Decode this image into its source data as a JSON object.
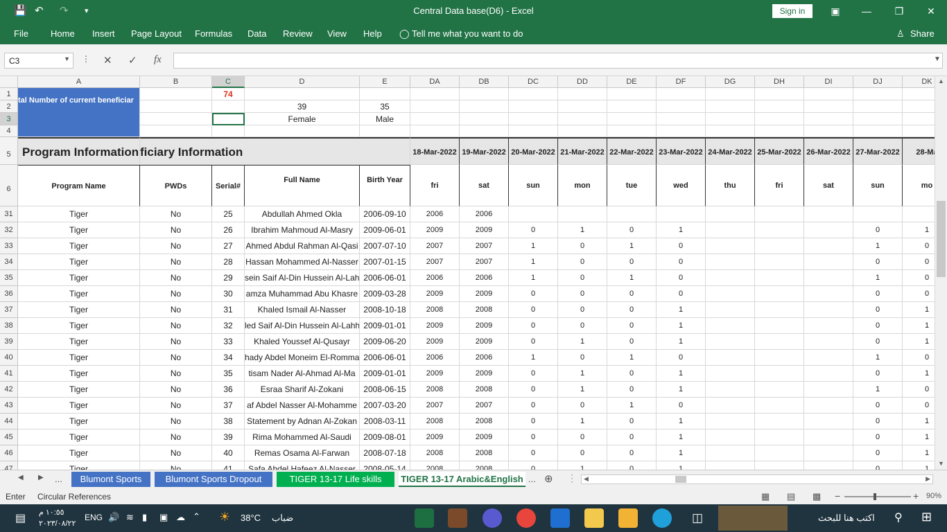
{
  "window": {
    "title": "Central Data base(D6)  -  Excel",
    "sign_in": "Sign in",
    "share": "Share"
  },
  "ribbon": {
    "tabs": [
      "File",
      "Home",
      "Insert",
      "Page Layout",
      "Formulas",
      "Data",
      "Review",
      "View",
      "Help"
    ],
    "tell_me": "Tell me what you want to do"
  },
  "formula_bar": {
    "name_box": "C3",
    "fx": "fx",
    "content": ""
  },
  "columns": [
    {
      "label": "A",
      "w": 176
    },
    {
      "label": "B",
      "w": 104
    },
    {
      "label": "C",
      "w": 47
    },
    {
      "label": "D",
      "w": 166
    },
    {
      "label": "E",
      "w": 73
    },
    {
      "label": "DA",
      "w": 71
    },
    {
      "label": "DB",
      "w": 71
    },
    {
      "label": "DC",
      "w": 71
    },
    {
      "label": "DD",
      "w": 71
    },
    {
      "label": "DE",
      "w": 71
    },
    {
      "label": "DF",
      "w": 71
    },
    {
      "label": "DG",
      "w": 71
    },
    {
      "label": "DH",
      "w": 71
    },
    {
      "label": "DI",
      "w": 71
    },
    {
      "label": "DJ",
      "w": 71
    },
    {
      "label": "DK",
      "w": 71
    }
  ],
  "header_rows": {
    "row1_c": "74",
    "row2_a": "tal Number of current beneficiar",
    "row2_d": "39",
    "row2_e": "35",
    "row3_d": "Female",
    "row3_e": "Male",
    "row5_a": "Program Information",
    "row5_b": "ficiary Information",
    "dates": [
      "18-Mar-2022",
      "19-Mar-2022",
      "20-Mar-2022",
      "21-Mar-2022",
      "22-Mar-2022",
      "23-Mar-2022",
      "24-Mar-2022",
      "25-Mar-2022",
      "26-Mar-2022",
      "27-Mar-2022",
      "28-Ma"
    ],
    "days": [
      "fri",
      "sat",
      "sun",
      "mon",
      "tue",
      "wed",
      "thu",
      "fri",
      "sat",
      "sun",
      "mo"
    ],
    "row6": [
      "Program Name",
      "PWDs",
      "Serial#",
      "Full Name",
      "Birth Year"
    ]
  },
  "data_rows": [
    {
      "row": "31",
      "cells": [
        "Tiger",
        "No",
        "25",
        "Abdullah Ahmed Okla",
        "2006-09-10",
        "2006",
        "2006",
        "",
        "",
        "",
        "",
        "",
        "",
        "",
        "",
        ""
      ]
    },
    {
      "row": "32",
      "cells": [
        "Tiger",
        "No",
        "26",
        "Ibrahim Mahmoud Al-Masry",
        "2009-06-01",
        "2009",
        "2009",
        "0",
        "1",
        "0",
        "1",
        "",
        "",
        "",
        "0",
        "1"
      ]
    },
    {
      "row": "33",
      "cells": [
        "Tiger",
        "No",
        "27",
        "Ahmed Abdul Rahman Al-Qasi",
        "2007-07-10",
        "2007",
        "2007",
        "1",
        "0",
        "1",
        "0",
        "",
        "",
        "",
        "1",
        "0"
      ]
    },
    {
      "row": "34",
      "cells": [
        "Tiger",
        "No",
        "28",
        "Hassan Mohammed Al-Nasser",
        "2007-01-15",
        "2007",
        "2007",
        "1",
        "0",
        "0",
        "0",
        "",
        "",
        "",
        "0",
        "0"
      ]
    },
    {
      "row": "35",
      "cells": [
        "Tiger",
        "No",
        "29",
        "sein Saif Al-Din Hussein Al-Lah",
        "2006-06-01",
        "2006",
        "2006",
        "1",
        "0",
        "1",
        "0",
        "",
        "",
        "",
        "1",
        "0"
      ]
    },
    {
      "row": "36",
      "cells": [
        "Tiger",
        "No",
        "30",
        "amza Muhammad Abu Khasre",
        "2009-03-28",
        "2009",
        "2009",
        "0",
        "0",
        "0",
        "0",
        "",
        "",
        "",
        "0",
        "0"
      ]
    },
    {
      "row": "37",
      "cells": [
        "Tiger",
        "No",
        "31",
        "Khaled Ismail Al-Nasser",
        "2008-10-18",
        "2008",
        "2008",
        "0",
        "0",
        "0",
        "1",
        "",
        "",
        "",
        "0",
        "1"
      ]
    },
    {
      "row": "38",
      "cells": [
        "Tiger",
        "No",
        "32",
        "led Saif Al-Din Hussein Al-Lahh",
        "2009-01-01",
        "2009",
        "2009",
        "0",
        "0",
        "0",
        "1",
        "",
        "",
        "",
        "0",
        "1"
      ]
    },
    {
      "row": "39",
      "cells": [
        "Tiger",
        "No",
        "33",
        "Khaled Youssef Al-Qusayr",
        "2009-06-20",
        "2009",
        "2009",
        "0",
        "1",
        "0",
        "1",
        "",
        "",
        "",
        "0",
        "1"
      ]
    },
    {
      "row": "40",
      "cells": [
        "Tiger",
        "No",
        "34",
        "hady Abdel Moneim El-Romma",
        "2006-06-01",
        "2006",
        "2006",
        "1",
        "0",
        "1",
        "0",
        "",
        "",
        "",
        "1",
        "0"
      ]
    },
    {
      "row": "41",
      "cells": [
        "Tiger",
        "No",
        "35",
        "tisam Nader Al-Ahmad Al-Ma",
        "2009-01-01",
        "2009",
        "2009",
        "0",
        "1",
        "0",
        "1",
        "",
        "",
        "",
        "0",
        "1"
      ]
    },
    {
      "row": "42",
      "cells": [
        "Tiger",
        "No",
        "36",
        "Esraa Sharif Al-Zokani",
        "2008-06-15",
        "2008",
        "2008",
        "0",
        "1",
        "0",
        "1",
        "",
        "",
        "",
        "1",
        "0"
      ]
    },
    {
      "row": "43",
      "cells": [
        "Tiger",
        "No",
        "37",
        "af Abdel Nasser Al-Mohamme",
        "2007-03-20",
        "2007",
        "2007",
        "0",
        "0",
        "1",
        "0",
        "",
        "",
        "",
        "0",
        "0"
      ]
    },
    {
      "row": "44",
      "cells": [
        "Tiger",
        "No",
        "38",
        "Statement by Adnan Al-Zokan",
        "2008-03-11",
        "2008",
        "2008",
        "0",
        "1",
        "0",
        "1",
        "",
        "",
        "",
        "0",
        "1"
      ]
    },
    {
      "row": "45",
      "cells": [
        "Tiger",
        "No",
        "39",
        "Rima Mohammed Al-Saudi",
        "2009-08-01",
        "2009",
        "2009",
        "0",
        "0",
        "0",
        "1",
        "",
        "",
        "",
        "0",
        "1"
      ]
    },
    {
      "row": "46",
      "cells": [
        "Tiger",
        "No",
        "40",
        "Remas Osama Al-Farwan",
        "2008-07-18",
        "2008",
        "2008",
        "0",
        "0",
        "0",
        "1",
        "",
        "",
        "",
        "0",
        "1"
      ]
    },
    {
      "row": "47",
      "cells": [
        "Tiger",
        "No",
        "41",
        "Safa Abdel Hafeez Al-Nasser",
        "2008-05-14",
        "2008",
        "2008",
        "0",
        "1",
        "0",
        "1",
        "",
        "",
        "",
        "0",
        "1"
      ]
    }
  ],
  "sheet_tabs": [
    {
      "label": "Blumont Sports",
      "color": "#4472c4"
    },
    {
      "label": "Blumont Sports Dropout",
      "color": "#4472c4"
    },
    {
      "label": "TIGER 13-17 Life skills",
      "color": "#00b050"
    },
    {
      "label": "TIGER 13-17 Arabic&English",
      "color": "#ffffff"
    }
  ],
  "tab_nav_more": "...",
  "status": {
    "mode": "Enter",
    "message": "Circular References",
    "zoom": "90%"
  },
  "taskbar": {
    "search_placeholder": "اكتب هنا للبحث",
    "weather_temp": "38°C",
    "weather_desc": "ضباب",
    "lang": "ENG",
    "time": "١٠:٥٥ م",
    "date": "٢٠٢٣/٠٨/٢٢"
  },
  "colors": {
    "excel_green": "#217346",
    "header_blue": "#4472c4",
    "red_value": "#e0301e"
  }
}
